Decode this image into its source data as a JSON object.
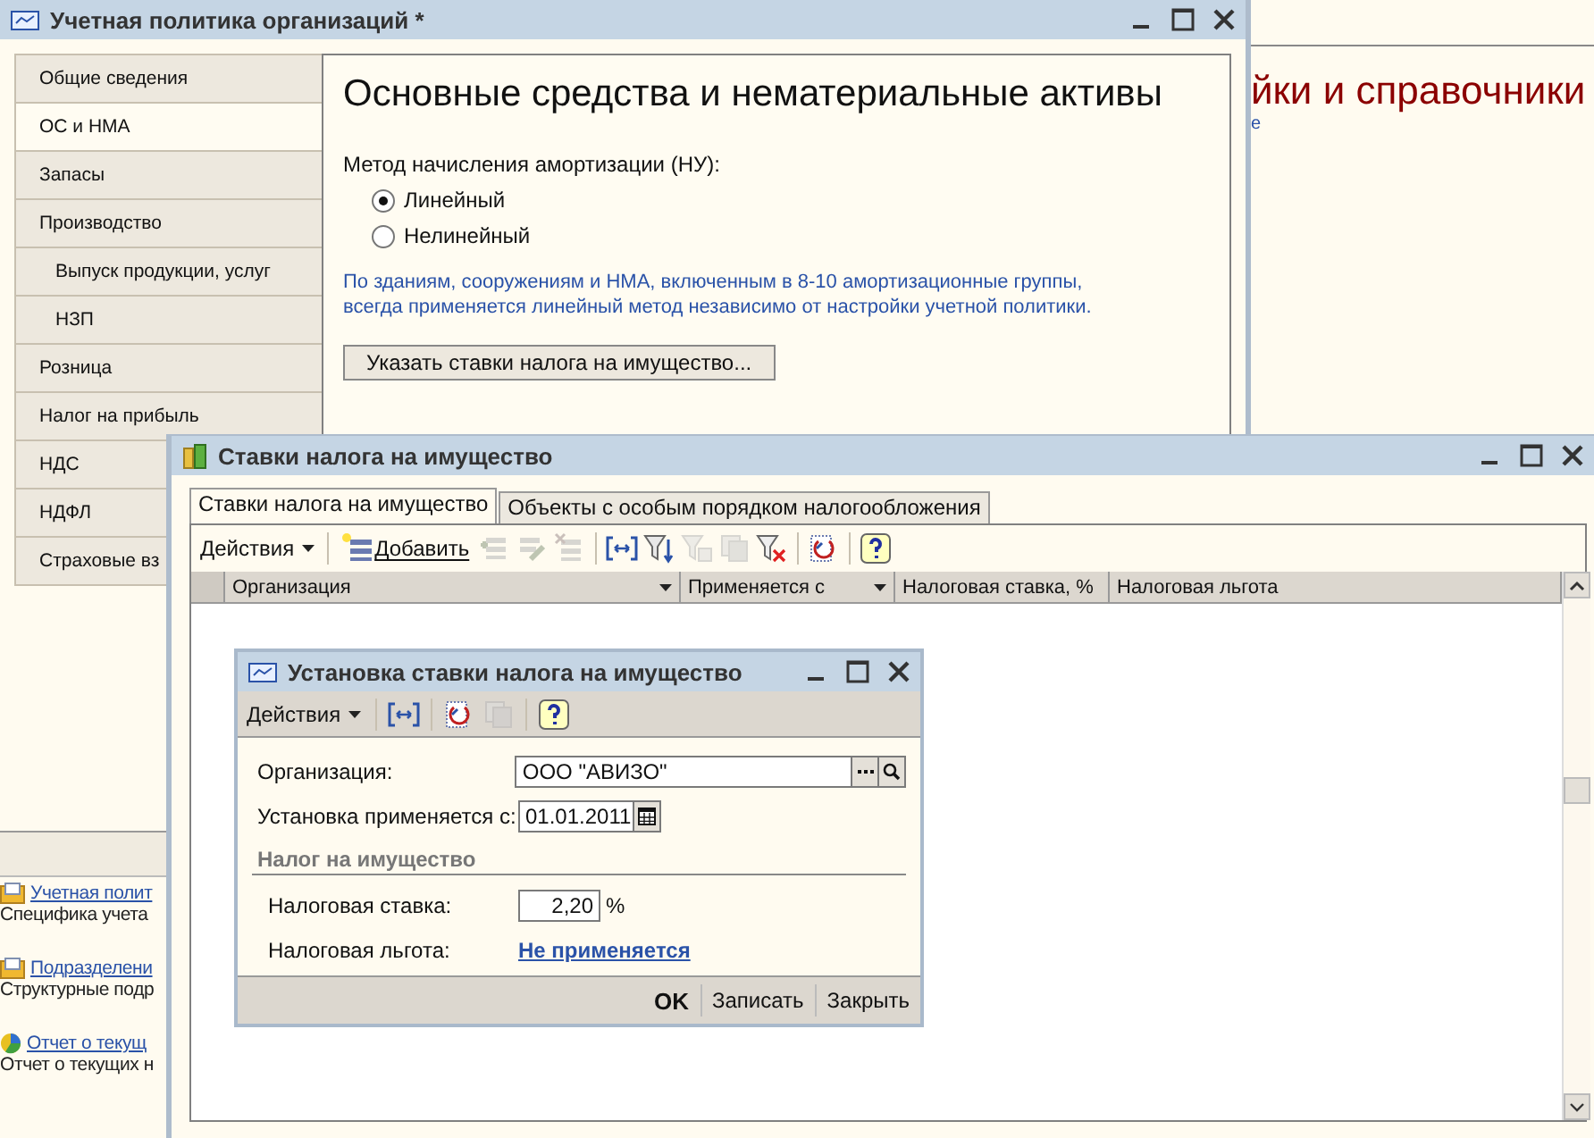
{
  "background": {
    "heading": "йки и справочники",
    "subtitle": "е",
    "links": [
      {
        "kind": "document",
        "title": "Учетная полит",
        "description": "Специфика учета"
      },
      {
        "kind": "document",
        "title": "Подразделени",
        "description": "Структурные подр"
      },
      {
        "kind": "report",
        "title": "Отчет о текущ",
        "description": "Отчет о текущих н"
      }
    ]
  },
  "policy_window": {
    "title": "Учетная политика организаций *",
    "sections": [
      {
        "label": "Общие сведения",
        "selected": false
      },
      {
        "label": "ОС и НМА",
        "selected": true
      },
      {
        "label": "Запасы",
        "selected": false
      },
      {
        "label": "Производство",
        "selected": false,
        "children": [
          {
            "label": "Выпуск продукции, услуг",
            "selected": false
          },
          {
            "label": "НЗП",
            "selected": false
          }
        ]
      },
      {
        "label": "Розница",
        "selected": false
      },
      {
        "label": "Налог на прибыль",
        "selected": false
      },
      {
        "label": "НДС",
        "selected": false
      },
      {
        "label": "НДФЛ",
        "selected": false
      },
      {
        "label": "Страховые вз",
        "selected": false
      }
    ],
    "heading": "Основные средства и нематериальные активы",
    "method_label": "Метод начисления амортизации (НУ):",
    "methods": [
      {
        "label": "Линейный",
        "selected": true
      },
      {
        "label": "Нелинейный",
        "selected": false
      }
    ],
    "note": "По зданиям, сооружениям и НМА, включенным в 8-10 амортизационные группы,\nвсегда применяется линейный метод независимо от настройки учетной политики.",
    "button": "Указать ставки налога на имущество..."
  },
  "rates_window": {
    "title": "Ставки налога на имущество",
    "tabs": [
      {
        "label": "Ставки налога на имущество",
        "selected": true
      },
      {
        "label": "Объекты с особым порядком налогообложения",
        "selected": false
      }
    ],
    "actions_menu": "Действия",
    "add_button": "Добавить",
    "tools": [
      {
        "disabled": true
      },
      {
        "disabled": true
      },
      {
        "disabled": true
      },
      {
        "disabled": false
      },
      {
        "disabled": false
      },
      {
        "disabled": true
      },
      {
        "disabled": true
      },
      {
        "disabled": false
      },
      {
        "disabled": false
      },
      {
        "disabled": false
      }
    ],
    "columns": [
      {
        "label": "Организация",
        "dropdown": true
      },
      {
        "label": "Применяется с",
        "dropdown": true
      },
      {
        "label": "Налоговая ставка, %",
        "dropdown": false
      },
      {
        "label": "Налоговая льгота",
        "dropdown": false
      }
    ]
  },
  "form_window": {
    "title": "Установка ставки налога на имущество",
    "actions_menu": "Действия",
    "tools": [
      {
        "disabled": false
      },
      {
        "disabled": false
      },
      {
        "disabled": true
      },
      {
        "disabled": false
      }
    ],
    "organization": {
      "label": "Организация:",
      "value": "ООО \"АВИЗО\""
    },
    "start_date": {
      "label": "Установка применяется с:",
      "value": "01.01.2011"
    },
    "section": "Налог на имущество",
    "rate": {
      "label": "Налоговая ставка:",
      "value": "2,20",
      "unit": "%"
    },
    "benefit": {
      "label": "Налоговая льгота:",
      "link": "Не применяется"
    },
    "buttons": [
      {
        "label": "OK",
        "default": true
      },
      {
        "label": "Записать",
        "default": false
      },
      {
        "label": "Закрыть",
        "default": false
      }
    ]
  }
}
